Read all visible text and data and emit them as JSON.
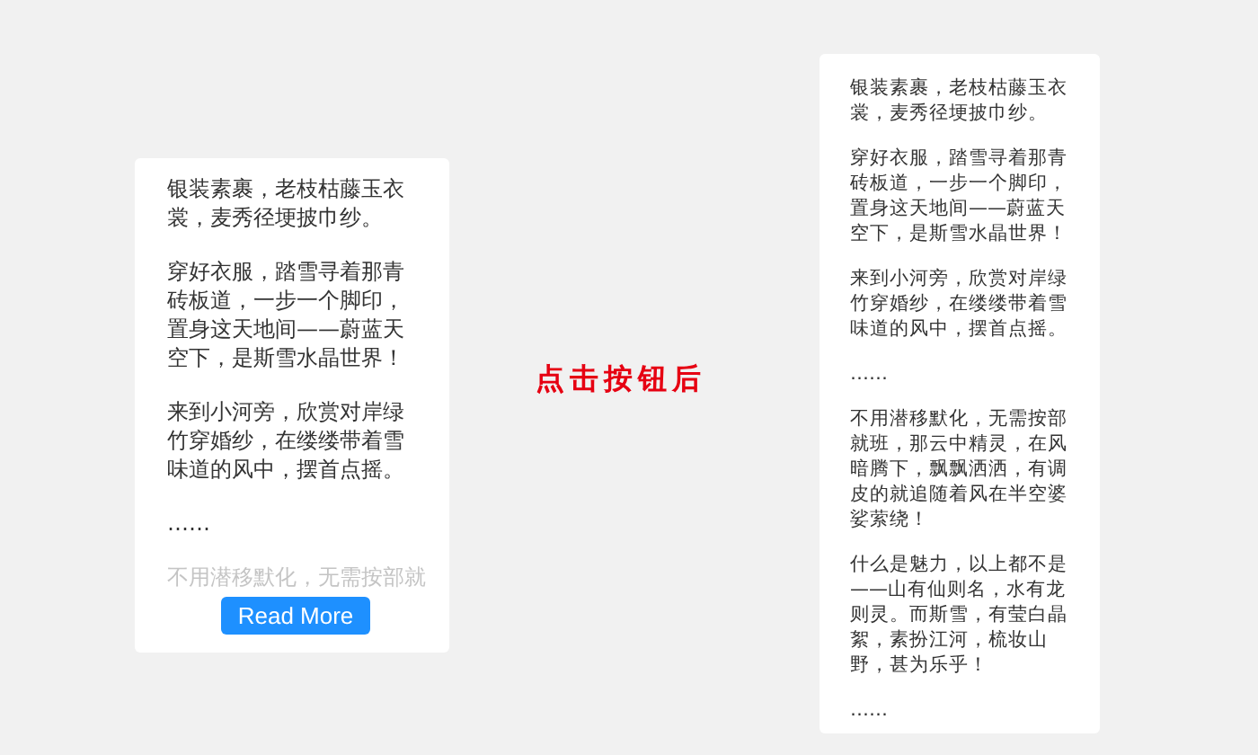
{
  "collapsed_card": {
    "paragraphs": [
      "银装素裹，老枝枯藤玉衣裳，麦秀径埂披巾纱。",
      "穿好衣服，踏雪寻着那青砖板道，一步一个脚印，置身这天地间——蔚蓝天空下，是斯雪水晶世界！",
      "来到小河旁，欣赏对岸绿竹穿婚纱，在缕缕带着雪味道的风中，摆首点摇。",
      "……"
    ],
    "faded_text": "不用潜移默化，无需按部就",
    "button": "Read More"
  },
  "caption": "点击按钮后",
  "expanded_card": {
    "paragraphs": [
      "银装素裹，老枝枯藤玉衣裳，麦秀径埂披巾纱。",
      "穿好衣服，踏雪寻着那青砖板道，一步一个脚印，置身这天地间——蔚蓝天空下，是斯雪水晶世界！",
      "来到小河旁，欣赏对岸绿竹穿婚纱，在缕缕带着雪味道的风中，摆首点摇。",
      "……",
      "不用潜移默化，无需按部就班，那云中精灵，在风暗腾下，飘飘洒洒，有调皮的就追随着风在半空婆娑萦绕！",
      "什么是魅力，以上都不是——山有仙则名，水有龙则灵。而斯雪，有莹白晶絮，素扮江河，梳妆山野，甚为乐乎！",
      "……"
    ]
  }
}
